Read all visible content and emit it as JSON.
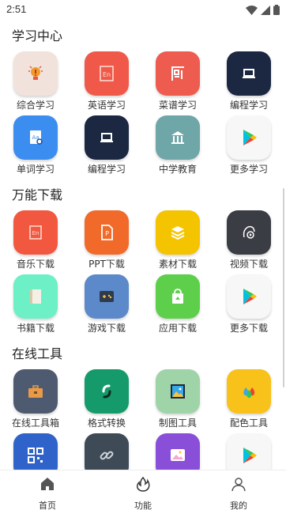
{
  "status": {
    "time": "2:51"
  },
  "colors": {
    "accent": "#333333",
    "background": "#ffffff"
  },
  "sections": [
    {
      "title": "学习中心",
      "items": [
        {
          "label": "综合学习",
          "icon": "lightbulb-icon",
          "bg": "#f2e2dc"
        },
        {
          "label": "英语学习",
          "icon": "english-book-icon",
          "bg": "#f0594a"
        },
        {
          "label": "菜谱学习",
          "icon": "kitchen-icon",
          "bg": "#ee5b4f"
        },
        {
          "label": "编程学习",
          "icon": "laptop-icon",
          "bg": "#1c2742"
        },
        {
          "label": "单词学习",
          "icon": "dictionary-icon",
          "bg": "#3b8ef0"
        },
        {
          "label": "编程学习",
          "icon": "laptop-icon",
          "bg": "#1c2742"
        },
        {
          "label": "中学教育",
          "icon": "school-icon",
          "bg": "#6fa6a8"
        },
        {
          "label": "更多学习",
          "icon": "play-store-icon",
          "bg": "#f7f7f7"
        }
      ]
    },
    {
      "title": "万能下载",
      "items": [
        {
          "label": "音乐下载",
          "icon": "music-file-icon",
          "bg": "#f2573f"
        },
        {
          "label": "PPT下载",
          "icon": "ppt-icon",
          "bg": "#f16a2a"
        },
        {
          "label": "素材下载",
          "icon": "layers-icon",
          "bg": "#f5c400"
        },
        {
          "label": "视频下载",
          "icon": "video-file-icon",
          "bg": "#3a3d44"
        },
        {
          "label": "书籍下载",
          "icon": "book-icon",
          "bg": "#6ef0c6"
        },
        {
          "label": "游戏下载",
          "icon": "game-icon",
          "bg": "#5b89c9"
        },
        {
          "label": "应用下载",
          "icon": "app-bag-icon",
          "bg": "#5dcf4a"
        },
        {
          "label": "更多下载",
          "icon": "play-store-icon",
          "bg": "#f7f7f7"
        }
      ]
    },
    {
      "title": "在线工具",
      "items": [
        {
          "label": "在线工具箱",
          "icon": "toolbox-icon",
          "bg": "#4d5a6f"
        },
        {
          "label": "格式转换",
          "icon": "convert-icon",
          "bg": "#159a6b"
        },
        {
          "label": "制图工具",
          "icon": "image-frame-icon",
          "bg": "#9fd4a9"
        },
        {
          "label": "配色工具",
          "icon": "color-drops-icon",
          "bg": "#f8c21a"
        },
        {
          "label": "",
          "icon": "qr-code-icon",
          "bg": "#2f63c9"
        },
        {
          "label": "",
          "icon": "link-icon",
          "bg": "#3f4a57"
        },
        {
          "label": "",
          "icon": "gallery-icon",
          "bg": "#8a4fd8"
        },
        {
          "label": "",
          "icon": "play-store-icon",
          "bg": "#f7f7f7"
        }
      ]
    }
  ],
  "bottom_nav": [
    {
      "label": "首页",
      "icon": "home-icon"
    },
    {
      "label": "功能",
      "icon": "fire-icon"
    },
    {
      "label": "我的",
      "icon": "user-icon"
    }
  ]
}
